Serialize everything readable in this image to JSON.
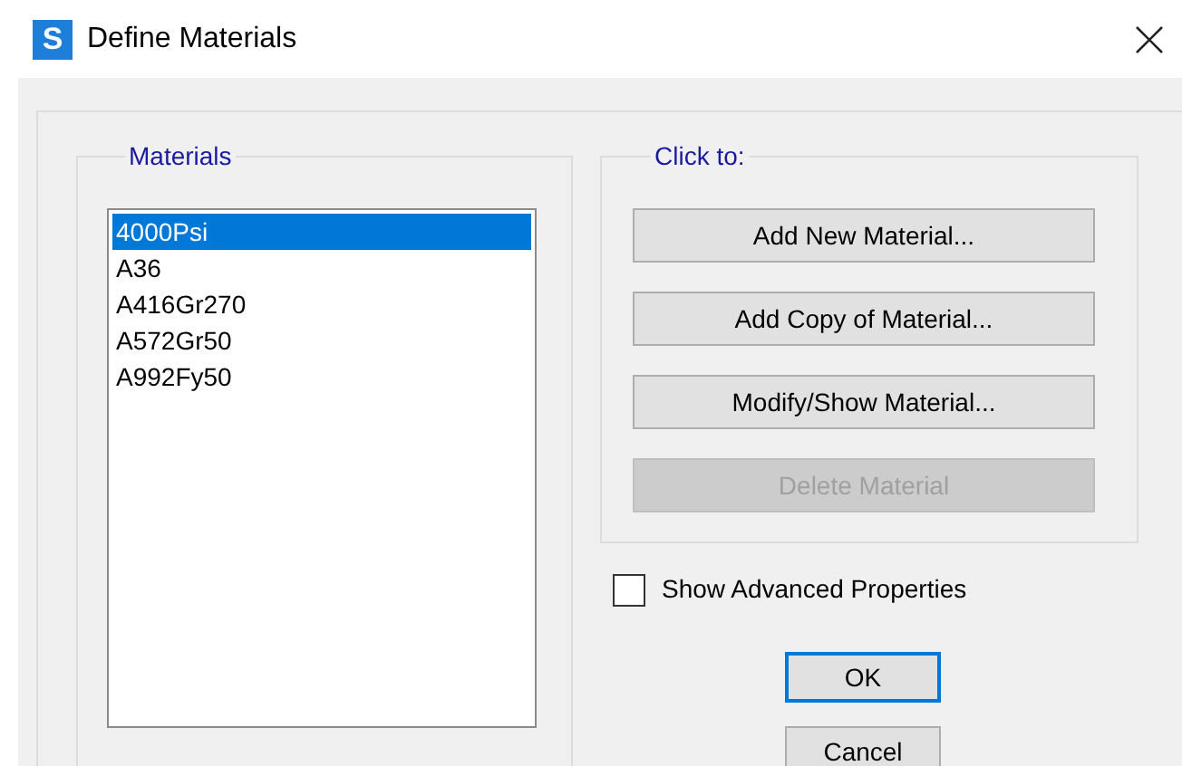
{
  "window": {
    "title": "Define Materials",
    "app_icon_letter": "S"
  },
  "materials": {
    "label": "Materials",
    "items": [
      {
        "name": "4000Psi",
        "selected": true
      },
      {
        "name": "A36",
        "selected": false
      },
      {
        "name": "A416Gr270",
        "selected": false
      },
      {
        "name": "A572Gr50",
        "selected": false
      },
      {
        "name": "A992Fy50",
        "selected": false
      }
    ]
  },
  "click_to": {
    "label": "Click to:",
    "buttons": [
      {
        "label": "Add New Material...",
        "disabled": false
      },
      {
        "label": "Add Copy of Material...",
        "disabled": false
      },
      {
        "label": "Modify/Show Material...",
        "disabled": false
      },
      {
        "label": "Delete Material",
        "disabled": true
      }
    ]
  },
  "show_advanced": {
    "label": "Show Advanced Properties",
    "checked": false
  },
  "dialog_buttons": [
    {
      "label": "OK",
      "default": true
    },
    {
      "label": "Cancel",
      "default": false
    }
  ]
}
